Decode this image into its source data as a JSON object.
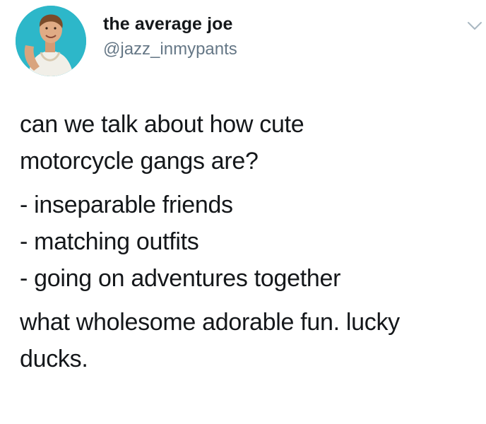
{
  "author": {
    "display_name": "the average joe",
    "handle": "@jazz_inmypants",
    "avatar_icon": "profile-photo-avatar"
  },
  "menu": {
    "icon": "chevron-down-icon"
  },
  "tweet": {
    "paragraphs": [
      {
        "lines": [
          "can we talk about how cute",
          "motorcycle gangs are?"
        ]
      },
      {
        "lines": [
          "- inseparable friends",
          "- matching outfits",
          "- going on adventures together"
        ]
      },
      {
        "lines": [
          "what wholesome adorable fun. lucky",
          "ducks."
        ]
      }
    ]
  },
  "colors": {
    "text_primary": "#14171a",
    "text_secondary": "#657786",
    "avatar_background": "#2db7c9"
  }
}
